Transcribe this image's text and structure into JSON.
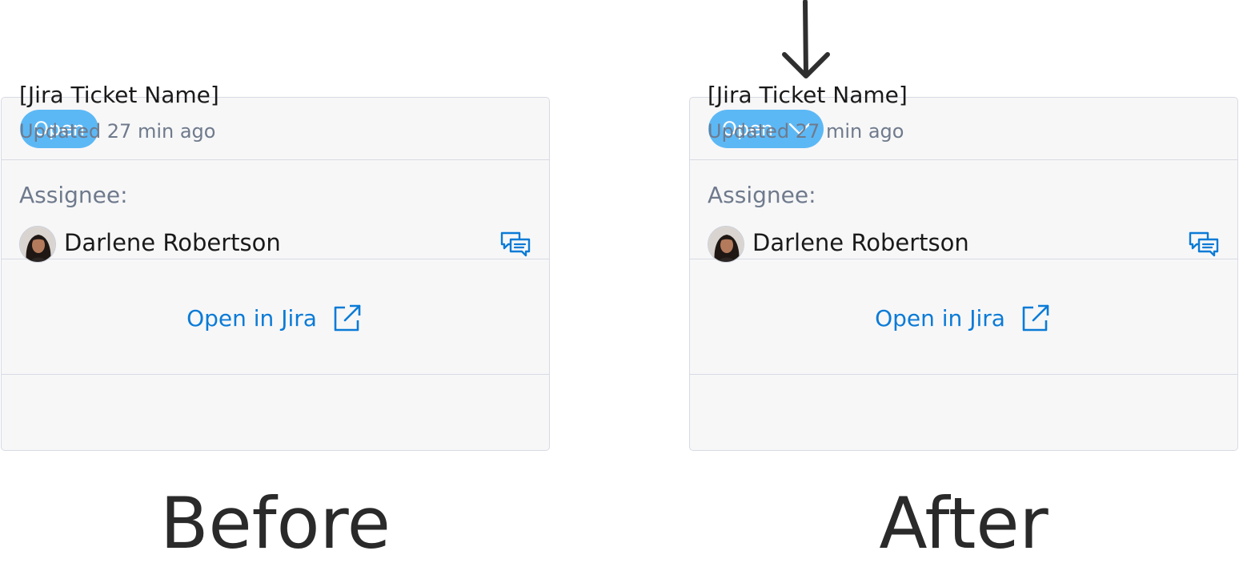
{
  "panels": [
    {
      "status": {
        "label": "Open",
        "has_dropdown": false
      },
      "ticket": {
        "name": "[Jira Ticket Name]",
        "updated": "Updated 27 min ago"
      },
      "assignee": {
        "label": "Assignee:",
        "name": "Darlene Robertson"
      },
      "footer": {
        "link_label": "Open in Jira"
      },
      "caption": "Before"
    },
    {
      "status": {
        "label": "Open",
        "has_dropdown": true
      },
      "ticket": {
        "name": "[Jira Ticket Name]",
        "updated": "Updated 27 min ago"
      },
      "assignee": {
        "label": "Assignee:",
        "name": "Darlene Robertson"
      },
      "footer": {
        "link_label": "Open in Jira"
      },
      "caption": "After"
    }
  ],
  "icons": {
    "chevron": "chevron-down-icon",
    "chat": "chat-icon",
    "external_link": "external-link-icon",
    "pointer": "down-arrow-icon"
  },
  "colors": {
    "status_pill": "#5cb8f5",
    "link": "#0b7bd6",
    "muted_text": "#6f7a8c",
    "card_bg": "#f7f7f8",
    "card_border": "#d8dbe3"
  }
}
